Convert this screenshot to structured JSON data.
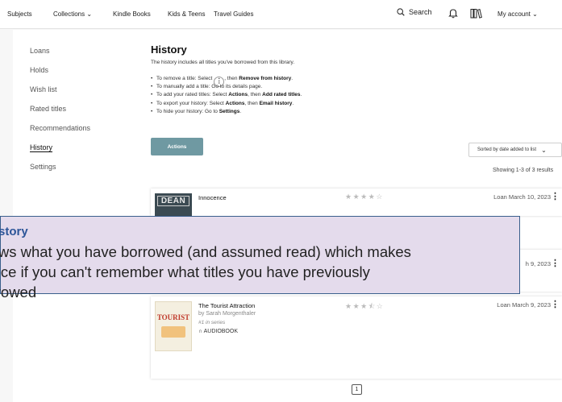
{
  "topnav": {
    "items": [
      "Subjects",
      "Collections",
      "Kindle Books",
      "Kids & Teens",
      "Travel Guides"
    ],
    "search_label": "Search",
    "account_label": "My account"
  },
  "sidebar": {
    "items": [
      "Loans",
      "Holds",
      "Wish list",
      "Rated titles",
      "Recommendations",
      "History",
      "Settings"
    ],
    "active": "History"
  },
  "main": {
    "title": "History",
    "intro": "The history includes all titles you've borrowed from this library.",
    "bullets": [
      {
        "pre": "To remove a title: Select",
        "bold": "Remove from history",
        "mid": ", then",
        "post": "."
      },
      {
        "text": "To manually add a title: Go to its details page."
      },
      {
        "pre": "To add your rated titles: Select",
        "bold1": "Actions",
        "mid": ", then",
        "bold2": "Add rated titles",
        "post": "."
      },
      {
        "pre": "To export your history: Select",
        "bold1": "Actions",
        "mid": ", then",
        "bold2": "Email history",
        "post": "."
      },
      {
        "pre": "To hide your history: Go to",
        "bold1": "Settings",
        "post": "."
      }
    ],
    "actions_label": "Actions",
    "sort_label": "Sorted by date added to list",
    "showing": "Showing 1-3 of 3 results"
  },
  "titles": [
    {
      "title": "Innocence",
      "cover_text": "DEAN",
      "rating": 4,
      "loan": "Loan March 10, 2023"
    },
    {
      "loan_partial": "h 9, 2023"
    },
    {
      "title": "The Tourist Attraction",
      "author": "by Sarah Morgenthaler",
      "series": "#1 in series",
      "format": "AUDIOBOOK",
      "cover_text": "TOURIST",
      "rating": 3.5,
      "loan": "Loan March 9, 2023"
    }
  ],
  "pagination": {
    "current": "1"
  },
  "callout": {
    "title": "History",
    "lines": [
      "shows what you have borrowed (and assumed read) which makes",
      "is nice if you can't remember what titles you have previously",
      "borrowed"
    ]
  },
  "colors": {
    "actions_btn": "#6f99a2",
    "callout_bg": "#e4dbec",
    "callout_border": "#3a5f8c",
    "callout_title": "#2c5598"
  }
}
